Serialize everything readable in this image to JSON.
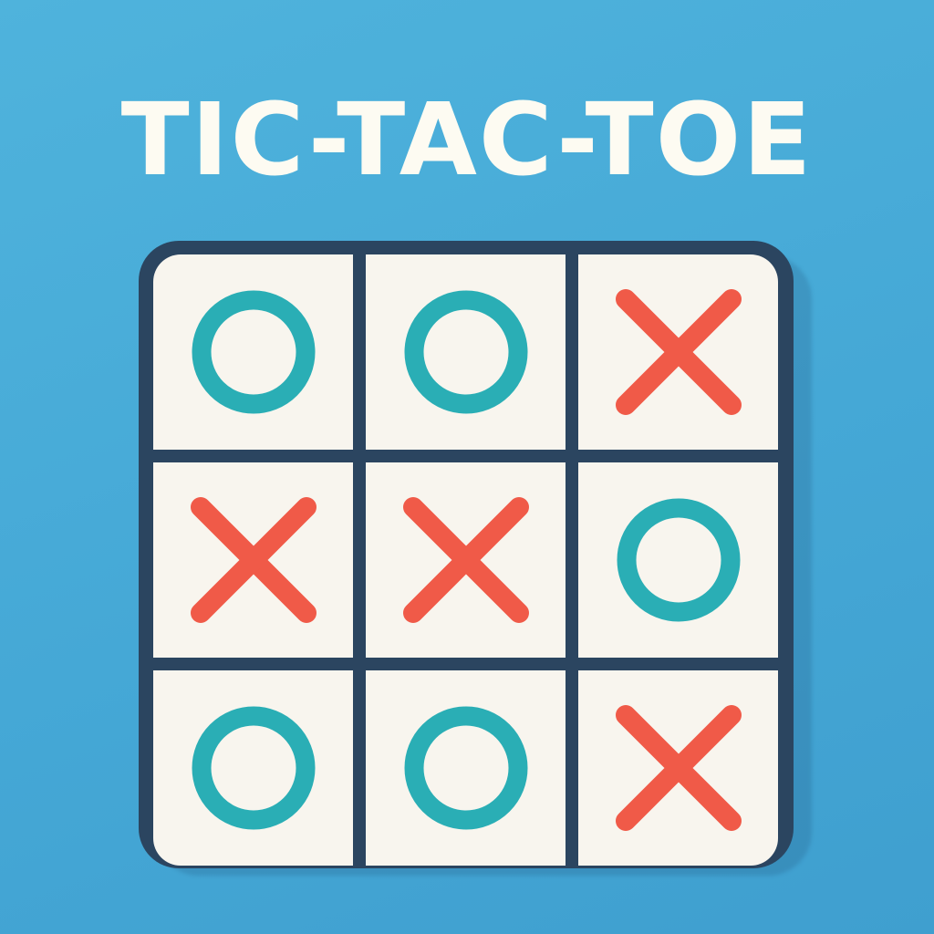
{
  "title": "TIC-TAC-TOE",
  "colors": {
    "background": "#45a8d6",
    "board_frame": "#2b4560",
    "cell_fill": "#f8f5ee",
    "o_mark": "#2aaeb5",
    "x_mark": "#f05a48",
    "title_text": "#fdfbf2"
  },
  "icons": {
    "o": "o-mark-icon",
    "x": "x-mark-icon"
  },
  "board": [
    [
      "O",
      "O",
      "X"
    ],
    [
      "X",
      "X",
      "O"
    ],
    [
      "O",
      "O",
      "X"
    ]
  ]
}
